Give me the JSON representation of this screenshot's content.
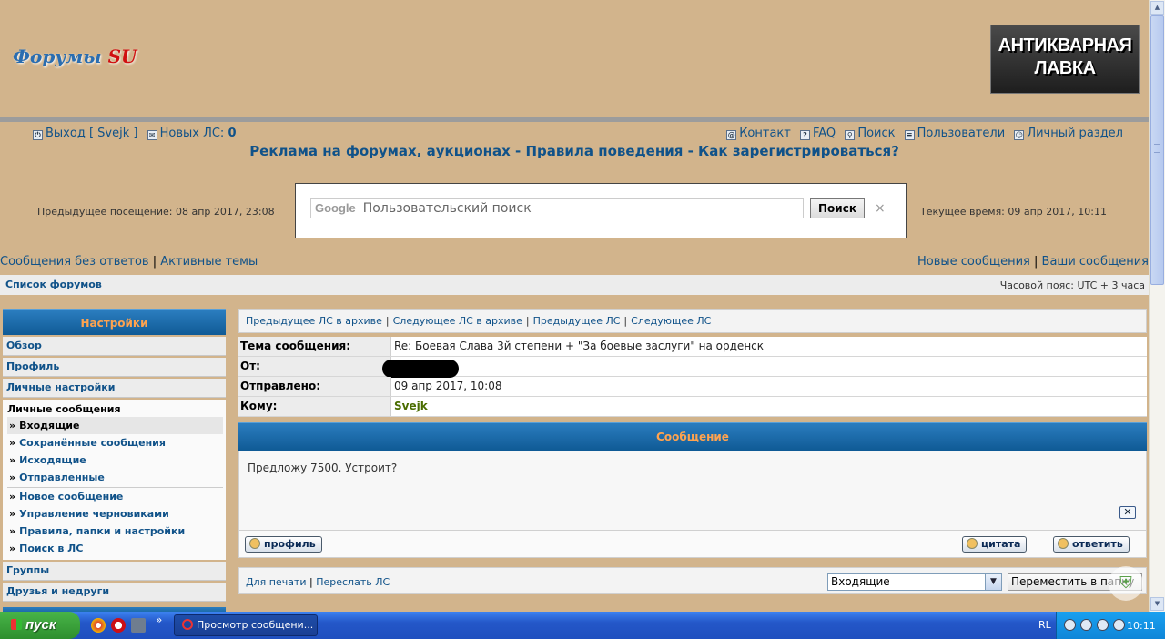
{
  "header": {
    "logo_main": "Форумы",
    "logo_accent": "SU",
    "banner_line1": "АНТИКВАРНАЯ",
    "banner_line2": "ЛАВКА"
  },
  "nav": {
    "logout": "Выход [ Svejk ]",
    "new_pm_label": "Новых ЛС:",
    "new_pm_count": "0",
    "contact": "Контакт",
    "faq": "FAQ",
    "search": "Поиск",
    "members": "Пользователи",
    "ucp": "Личный раздел"
  },
  "ad_links": "Реклама на форумах, аукционах - Правила поведения - Как зарегистрироваться?",
  "search_box": {
    "logo": "Google",
    "placeholder": "Пользовательский поиск",
    "button": "Поиск",
    "clear": "×"
  },
  "prev_visit": "Предыдущее посещение: 08 апр 2017, 23:08",
  "current_time": "Текущее время: 09 апр 2017, 10:11",
  "quick_left": {
    "unanswered": "Сообщения без ответов",
    "sep": "|",
    "active": "Активные темы"
  },
  "quick_right": {
    "new_posts": "Новые сообщения",
    "sep": "|",
    "your_posts": "Ваши сообщения"
  },
  "breadcrumb": {
    "index": "Список форумов",
    "timezone": "Часовой пояс: UTC + 3 часа"
  },
  "sidebar": {
    "title": "Настройки",
    "items": [
      "Обзор",
      "Профиль",
      "Личные настройки"
    ],
    "pm_title": "Личные сообщения",
    "pm_folders": [
      "Входящие",
      "Сохранённые сообщения",
      "Исходящие",
      "Отправленные"
    ],
    "pm_actions": [
      "Новое сообщение",
      "Управление черновиками",
      "Правила, папки и настройки",
      "Поиск в ЛС"
    ],
    "items_after": [
      "Группы",
      "Друзья и недруги"
    ],
    "bullet": "»"
  },
  "pm_nav": {
    "prev_archive": "Предыдущее ЛС в архиве",
    "next_archive": "Следующее ЛС в архиве",
    "prev": "Предыдущее ЛС",
    "next": "Следующее ЛС",
    "sep": "|"
  },
  "pm_header": {
    "subject_label": "Тема сообщения:",
    "subject": "Re: Боевая Слава 3й степени + \"За боевые заслуги\" на орденск",
    "from_label": "От:",
    "sent_label": "Отправлено:",
    "sent": "09 апр 2017, 10:08",
    "to_label": "Кому:",
    "to": "Svejk"
  },
  "message": {
    "title": "Сообщение",
    "text": "Предложу 7500. Устроит?"
  },
  "buttons": {
    "profile": "профиль",
    "quote": "цитата",
    "reply": "ответить"
  },
  "bottom": {
    "print": "Для печати",
    "sep": "|",
    "forward": "Переслать ЛС",
    "folder_selected": "Входящие",
    "move": "Переместить в папку"
  },
  "taskbar": {
    "start": "пуск",
    "task": "Просмотр сообщени...",
    "lang": "RL",
    "clock": "10:11"
  }
}
